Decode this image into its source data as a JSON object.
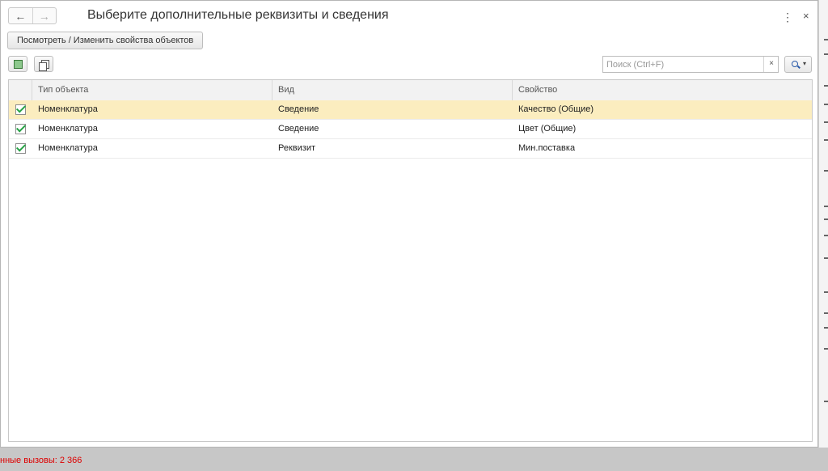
{
  "window": {
    "title": "Выберите дополнительные реквизиты и сведения",
    "back_icon": "←",
    "forward_icon": "→",
    "more_icon": "⋮",
    "close_icon": "×"
  },
  "toolbar": {
    "props_button": "Посмотреть / Изменить свойства объектов"
  },
  "search": {
    "placeholder": "Поиск (Ctrl+F)",
    "clear_icon": "×",
    "caret": "▾"
  },
  "table": {
    "columns": [
      "Тип объекта",
      "Вид",
      "Свойство"
    ],
    "rows": [
      {
        "checked": true,
        "type": "Номенклатура",
        "kind": "Сведение",
        "property": "Качество (Общие)",
        "selected": true
      },
      {
        "checked": true,
        "type": "Номенклатура",
        "kind": "Сведение",
        "property": "Цвет (Общие)",
        "selected": false
      },
      {
        "checked": true,
        "type": "Номенклатура",
        "kind": "Реквизит",
        "property": "Мин.поставка",
        "selected": false
      }
    ]
  },
  "status": {
    "text": "нные вызовы: 2 366"
  },
  "colors": {
    "selected_row": "#fbedbf",
    "check": "#25a245",
    "status_text": "#dd0000"
  }
}
